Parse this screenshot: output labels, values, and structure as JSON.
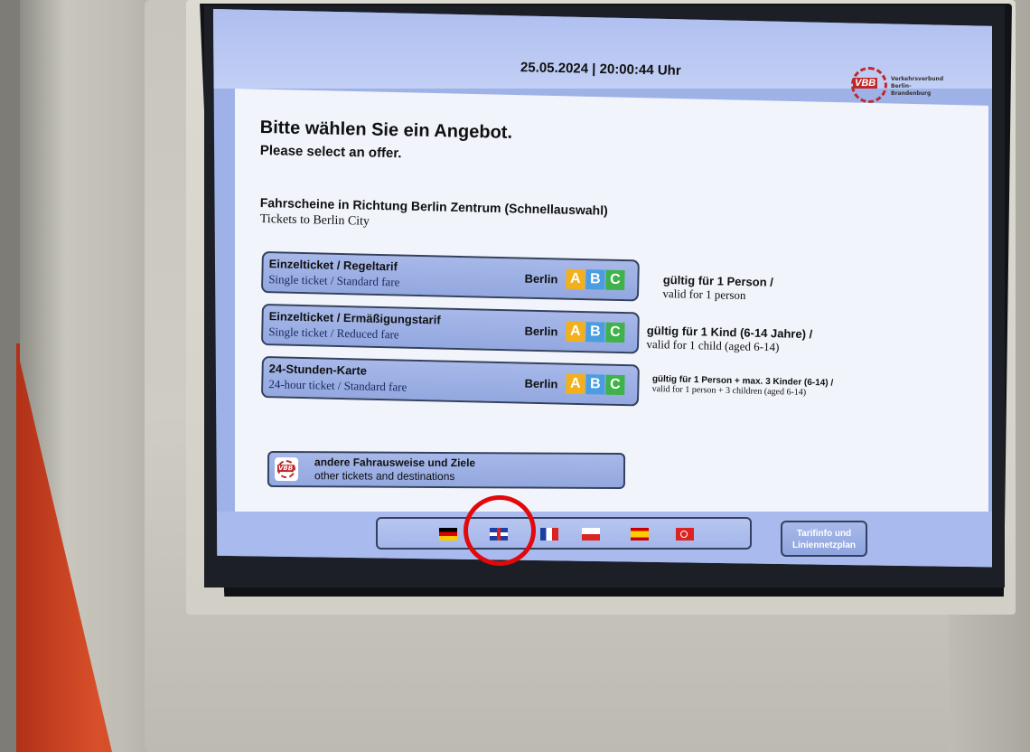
{
  "screen": {
    "datetime": "25.05.2024 | 20:00:44 Uhr",
    "logo": {
      "mark": "VBB",
      "text": "Verkehrsverbund Berlin-Brandenburg"
    },
    "title_de": "Bitte wählen Sie ein Angebot.",
    "title_en": "Please select an offer.",
    "section_de": "Fahrscheine in Richtung Berlin Zentrum (Schnellauswahl)",
    "section_en": "Tickets to Berlin City",
    "tickets": [
      {
        "name_de": "Einzelticket / Regeltarif",
        "name_en": "Single ticket / Standard fare",
        "area": "Berlin",
        "zones": [
          "A",
          "B",
          "C"
        ],
        "valid_de": "gültig für 1 Person /",
        "valid_en": "valid for 1 person"
      },
      {
        "name_de": "Einzelticket / Ermäßigungstarif",
        "name_en": "Single ticket / Reduced fare",
        "area": "Berlin",
        "zones": [
          "A",
          "B",
          "C"
        ],
        "valid_de": "gültig für 1 Kind (6-14 Jahre) /",
        "valid_en": "valid for 1 child (aged 6-14)"
      },
      {
        "name_de": "24-Stunden-Karte",
        "name_en": "24-hour ticket / Standard fare",
        "area": "Berlin",
        "zones": [
          "A",
          "B",
          "C"
        ],
        "valid_de": "gültig für 1 Person + max. 3 Kinder (6-14) /",
        "valid_en": "valid for 1 person + 3 children (aged 6-14)"
      }
    ],
    "other": {
      "de": "andere Fahrausweise und Ziele",
      "en": "other tickets and destinations",
      "logo": "VBB"
    },
    "languages": [
      "german-flag",
      "uk-flag",
      "french-flag",
      "polish-flag",
      "spanish-flag",
      "turkish-flag"
    ],
    "tarif_button": {
      "line1": "Tarifinfo und",
      "line2": "Liniennetzplan"
    }
  },
  "colors": {
    "zone_a": "#f2b01c",
    "zone_b": "#4a9de0",
    "zone_c": "#3fb24a",
    "highlight": "#e2080b"
  }
}
